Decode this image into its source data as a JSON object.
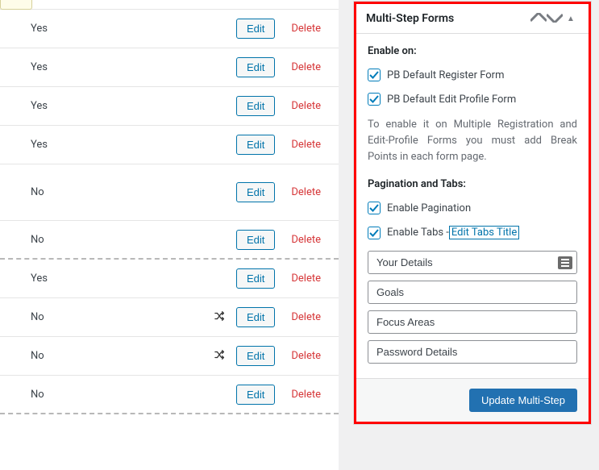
{
  "table": {
    "edit_label": "Edit",
    "delete_label": "Delete",
    "rows": [
      {
        "val": "",
        "shuffle": false,
        "tall": false,
        "dashed": false,
        "is_tag": true
      },
      {
        "val": "Yes",
        "shuffle": false,
        "tall": false,
        "dashed": false
      },
      {
        "val": "Yes",
        "shuffle": false,
        "tall": false,
        "dashed": false
      },
      {
        "val": "Yes",
        "shuffle": false,
        "tall": false,
        "dashed": false
      },
      {
        "val": "Yes",
        "shuffle": false,
        "tall": false,
        "dashed": false
      },
      {
        "val": "No",
        "shuffle": false,
        "tall": true,
        "dashed": false
      },
      {
        "val": "No",
        "shuffle": false,
        "tall": false,
        "dashed": true
      },
      {
        "val": "Yes",
        "shuffle": false,
        "tall": false,
        "dashed": false
      },
      {
        "val": "No",
        "shuffle": true,
        "tall": false,
        "dashed": false
      },
      {
        "val": "No",
        "shuffle": true,
        "tall": false,
        "dashed": false
      },
      {
        "val": "No",
        "shuffle": false,
        "tall": false,
        "dashed": true
      }
    ]
  },
  "panel": {
    "title": "Multi-Step Forms",
    "enable_on_label": "Enable on:",
    "checkboxes": {
      "register": "PB Default Register Form",
      "edit_profile": "PB Default Edit Profile Form",
      "pagination": "Enable Pagination",
      "tabs": "Enable Tabs - "
    },
    "help_text": "To enable it on Multiple Registration and Edit-Profile Forms you must add Break Points in each form page.",
    "pagination_label": "Pagination and Tabs:",
    "edit_tabs_title": "Edit Tabs Title",
    "tabs_inputs": [
      "Your Details",
      "Goals",
      "Focus Areas",
      "Password Details"
    ],
    "update_btn": "Update Multi-Step"
  }
}
